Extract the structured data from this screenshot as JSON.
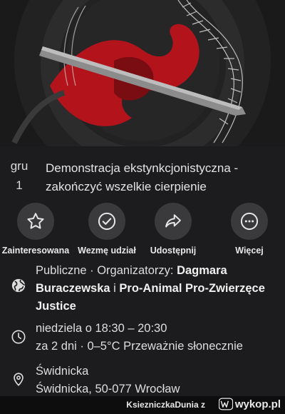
{
  "event": {
    "date_month": "gru",
    "date_day": "1",
    "title": "Demonstracja ekstynkcjonistyczna - zakończyć wszelkie cierpienie"
  },
  "actions": [
    {
      "label": "Zainteresowana",
      "icon": "star-icon"
    },
    {
      "label": "Wezmę udział",
      "icon": "check-circle-icon"
    },
    {
      "label": "Udostępnij",
      "icon": "share-icon"
    },
    {
      "label": "Więcej",
      "icon": "more-icon"
    }
  ],
  "info": {
    "privacy_prefix": "Publiczne · Organizatorzy: ",
    "organizer_1": "Dagmara Buraczewska",
    "connector": " i ",
    "organizer_2": "Pro-Animal Pro-Zwierzęce Justice",
    "time_line1": "niedziela o 18:30 – 20:30",
    "time_line2": "za 2 dni · 0–5°C Przeważnie słonecznie",
    "location_name": "Świdnicka",
    "location_address": "Świdnicka, 50-077 Wrocław"
  },
  "footer": {
    "username": "KsiezniczkaDunia",
    "separator": "z",
    "site": "wykop.pl"
  },
  "colors": {
    "background": "#1c1c1e",
    "button_circle": "#3a3a3c",
    "cover_red": "#b3141c"
  }
}
